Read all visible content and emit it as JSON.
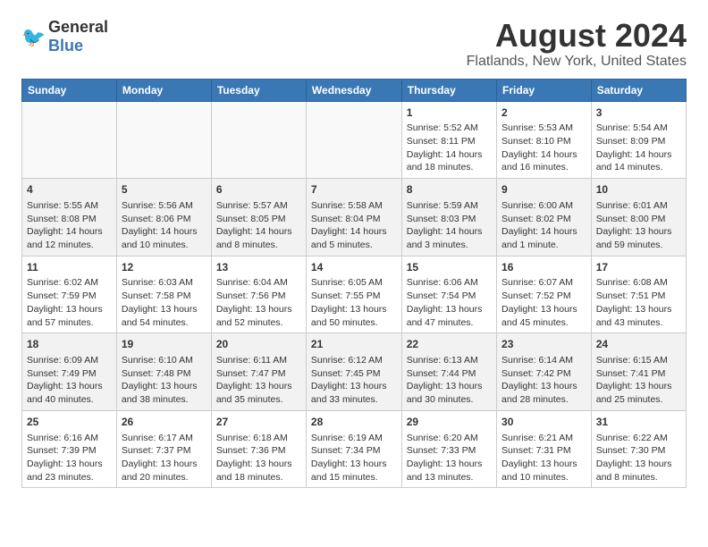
{
  "header": {
    "logo_general": "General",
    "logo_blue": "Blue",
    "title": "August 2024",
    "subtitle": "Flatlands, New York, United States"
  },
  "calendar": {
    "days_of_week": [
      "Sunday",
      "Monday",
      "Tuesday",
      "Wednesday",
      "Thursday",
      "Friday",
      "Saturday"
    ],
    "weeks": [
      [
        {
          "day": "",
          "info": ""
        },
        {
          "day": "",
          "info": ""
        },
        {
          "day": "",
          "info": ""
        },
        {
          "day": "",
          "info": ""
        },
        {
          "day": "1",
          "info": "Sunrise: 5:52 AM\nSunset: 8:11 PM\nDaylight: 14 hours\nand 18 minutes."
        },
        {
          "day": "2",
          "info": "Sunrise: 5:53 AM\nSunset: 8:10 PM\nDaylight: 14 hours\nand 16 minutes."
        },
        {
          "day": "3",
          "info": "Sunrise: 5:54 AM\nSunset: 8:09 PM\nDaylight: 14 hours\nand 14 minutes."
        }
      ],
      [
        {
          "day": "4",
          "info": "Sunrise: 5:55 AM\nSunset: 8:08 PM\nDaylight: 14 hours\nand 12 minutes."
        },
        {
          "day": "5",
          "info": "Sunrise: 5:56 AM\nSunset: 8:06 PM\nDaylight: 14 hours\nand 10 minutes."
        },
        {
          "day": "6",
          "info": "Sunrise: 5:57 AM\nSunset: 8:05 PM\nDaylight: 14 hours\nand 8 minutes."
        },
        {
          "day": "7",
          "info": "Sunrise: 5:58 AM\nSunset: 8:04 PM\nDaylight: 14 hours\nand 5 minutes."
        },
        {
          "day": "8",
          "info": "Sunrise: 5:59 AM\nSunset: 8:03 PM\nDaylight: 14 hours\nand 3 minutes."
        },
        {
          "day": "9",
          "info": "Sunrise: 6:00 AM\nSunset: 8:02 PM\nDaylight: 14 hours\nand 1 minute."
        },
        {
          "day": "10",
          "info": "Sunrise: 6:01 AM\nSunset: 8:00 PM\nDaylight: 13 hours\nand 59 minutes."
        }
      ],
      [
        {
          "day": "11",
          "info": "Sunrise: 6:02 AM\nSunset: 7:59 PM\nDaylight: 13 hours\nand 57 minutes."
        },
        {
          "day": "12",
          "info": "Sunrise: 6:03 AM\nSunset: 7:58 PM\nDaylight: 13 hours\nand 54 minutes."
        },
        {
          "day": "13",
          "info": "Sunrise: 6:04 AM\nSunset: 7:56 PM\nDaylight: 13 hours\nand 52 minutes."
        },
        {
          "day": "14",
          "info": "Sunrise: 6:05 AM\nSunset: 7:55 PM\nDaylight: 13 hours\nand 50 minutes."
        },
        {
          "day": "15",
          "info": "Sunrise: 6:06 AM\nSunset: 7:54 PM\nDaylight: 13 hours\nand 47 minutes."
        },
        {
          "day": "16",
          "info": "Sunrise: 6:07 AM\nSunset: 7:52 PM\nDaylight: 13 hours\nand 45 minutes."
        },
        {
          "day": "17",
          "info": "Sunrise: 6:08 AM\nSunset: 7:51 PM\nDaylight: 13 hours\nand 43 minutes."
        }
      ],
      [
        {
          "day": "18",
          "info": "Sunrise: 6:09 AM\nSunset: 7:49 PM\nDaylight: 13 hours\nand 40 minutes."
        },
        {
          "day": "19",
          "info": "Sunrise: 6:10 AM\nSunset: 7:48 PM\nDaylight: 13 hours\nand 38 minutes."
        },
        {
          "day": "20",
          "info": "Sunrise: 6:11 AM\nSunset: 7:47 PM\nDaylight: 13 hours\nand 35 minutes."
        },
        {
          "day": "21",
          "info": "Sunrise: 6:12 AM\nSunset: 7:45 PM\nDaylight: 13 hours\nand 33 minutes."
        },
        {
          "day": "22",
          "info": "Sunrise: 6:13 AM\nSunset: 7:44 PM\nDaylight: 13 hours\nand 30 minutes."
        },
        {
          "day": "23",
          "info": "Sunrise: 6:14 AM\nSunset: 7:42 PM\nDaylight: 13 hours\nand 28 minutes."
        },
        {
          "day": "24",
          "info": "Sunrise: 6:15 AM\nSunset: 7:41 PM\nDaylight: 13 hours\nand 25 minutes."
        }
      ],
      [
        {
          "day": "25",
          "info": "Sunrise: 6:16 AM\nSunset: 7:39 PM\nDaylight: 13 hours\nand 23 minutes."
        },
        {
          "day": "26",
          "info": "Sunrise: 6:17 AM\nSunset: 7:37 PM\nDaylight: 13 hours\nand 20 minutes."
        },
        {
          "day": "27",
          "info": "Sunrise: 6:18 AM\nSunset: 7:36 PM\nDaylight: 13 hours\nand 18 minutes."
        },
        {
          "day": "28",
          "info": "Sunrise: 6:19 AM\nSunset: 7:34 PM\nDaylight: 13 hours\nand 15 minutes."
        },
        {
          "day": "29",
          "info": "Sunrise: 6:20 AM\nSunset: 7:33 PM\nDaylight: 13 hours\nand 13 minutes."
        },
        {
          "day": "30",
          "info": "Sunrise: 6:21 AM\nSunset: 7:31 PM\nDaylight: 13 hours\nand 10 minutes."
        },
        {
          "day": "31",
          "info": "Sunrise: 6:22 AM\nSunset: 7:30 PM\nDaylight: 13 hours\nand 8 minutes."
        }
      ]
    ]
  }
}
